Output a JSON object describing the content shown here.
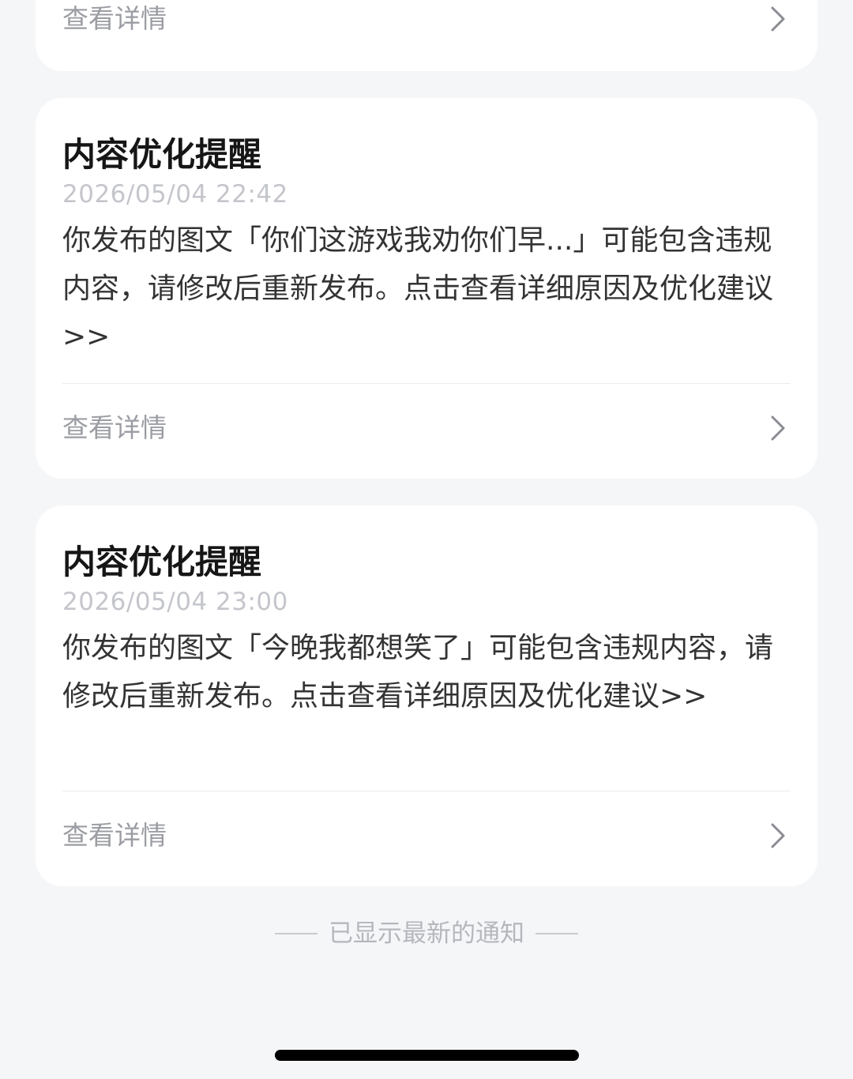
{
  "colors": {
    "background": "#f5f6f8",
    "card": "#ffffff",
    "title": "#161616",
    "timestamp": "#c4c6cc",
    "body_text": "#333333",
    "detail_text": "#9b9da3"
  },
  "cards": [
    {
      "detail_label": "查看详情",
      "chevron": "chevron-right-icon"
    },
    {
      "title": "内容优化提醒",
      "time": "2026/05/04 22:42",
      "body": "你发布的图文「你们这游戏我劝你们早...」可能包含违规内容，请修改后重新发布。点击查看详细原因及优化建议>>",
      "detail_label": "查看详情",
      "chevron": "chevron-right-icon"
    },
    {
      "title": "内容优化提醒",
      "time": "2026/05/04 23:00",
      "body": "你发布的图文「今晚我都想笑了」可能包含违规内容，请修改后重新发布。点击查看详细原因及优化建议>>",
      "detail_label": "查看详情",
      "chevron": "chevron-right-icon"
    }
  ],
  "footer": {
    "text": "已显示最新的通知"
  }
}
